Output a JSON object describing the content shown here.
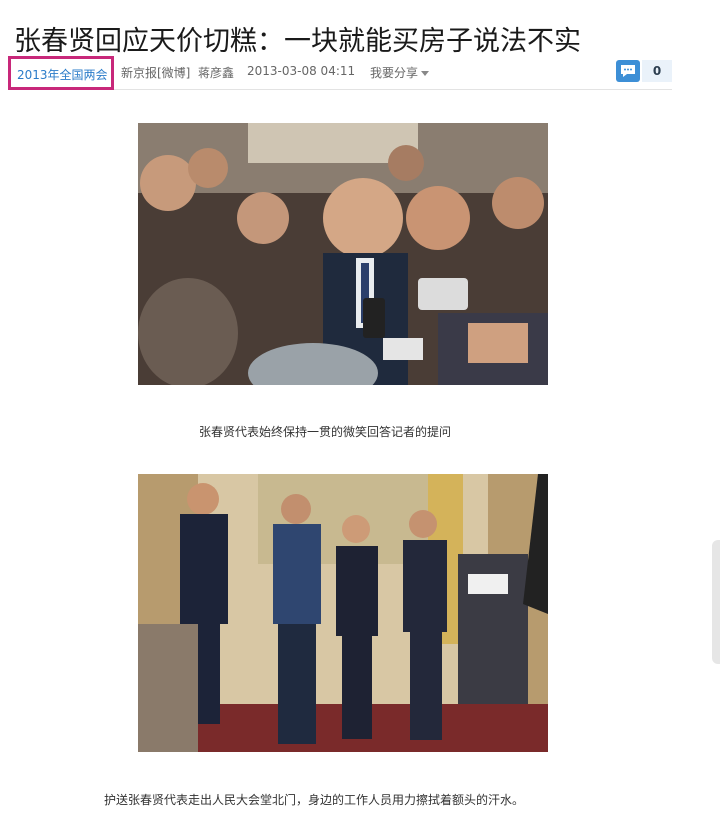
{
  "article": {
    "title": "张春贤回应天价切糕：一块就能买房子说法不实",
    "meta": {
      "tag": "2013年全国两会",
      "source": "新京报[微博]",
      "author": "蒋彦鑫",
      "datetime": "2013-03-08 04:11",
      "share_label": "我要分享",
      "comment_count": "0"
    },
    "photos": [
      {
        "icon": "photo-press-crowd",
        "caption": "张春贤代表始终保持一贯的微笑回答记者的提问"
      },
      {
        "icon": "photo-great-hall-exit",
        "caption": "护送张春贤代表走出人民大会堂北门，身边的工作人员用力擦拭着额头的汗水。"
      }
    ]
  },
  "colors": {
    "tag_link": "#2b7cc9",
    "tag_highlight_border": "#c8287a",
    "comment_button": "#3d8fd6",
    "comment_count_bg": "#eaf2fa"
  },
  "icons": {
    "comment": "speech-bubble-icon",
    "share": "chevron-down-icon"
  }
}
